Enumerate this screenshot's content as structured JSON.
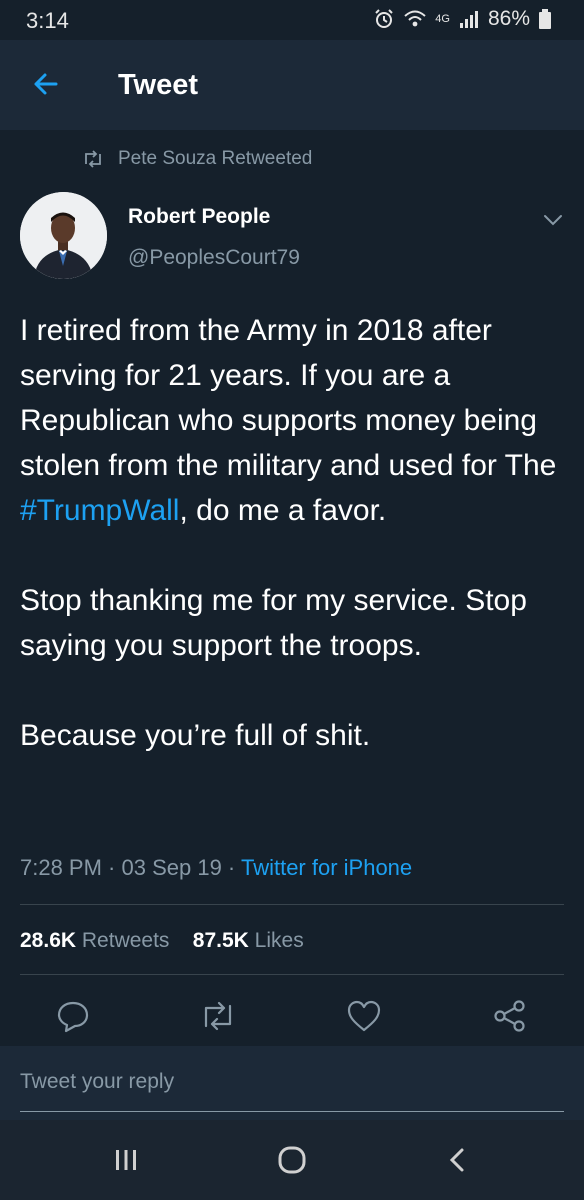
{
  "status_bar": {
    "time": "3:14",
    "battery": "86%",
    "network": "4G"
  },
  "header": {
    "title": "Tweet"
  },
  "retweet_context": {
    "text": "Pete Souza Retweeted"
  },
  "author": {
    "name": "Robert People",
    "handle": "@PeoplesCourt79"
  },
  "tweet": {
    "p1_before": "I retired from the Army in 2018 after serving for 21 years. If you are a Republican who supports money being stolen from the military and used for The ",
    "hashtag": "#TrumpWall",
    "p1_after": ", do me a favor.",
    "p2_line1": "Stop thanking me for my service.",
    "p2_line2": "Stop saying you support the troops.",
    "p3": "Because you’re full of shit."
  },
  "meta": {
    "time": "7:28 PM",
    "sep": " · ",
    "date": "03 Sep 19",
    "source": "Twitter for iPhone"
  },
  "stats": {
    "retweets_count": "28.6K",
    "retweets_label": "Retweets",
    "likes_count": "87.5K",
    "likes_label": "Likes"
  },
  "reply": {
    "placeholder": "Tweet your reply"
  },
  "colors": {
    "background": "#15202b",
    "header": "#1c2938",
    "accent": "#1da1f2",
    "muted": "#8899a6"
  },
  "icons": [
    "back-arrow-icon",
    "retweet-icon",
    "chevron-down-icon",
    "reply-icon",
    "retweet-icon",
    "like-icon",
    "share-icon",
    "recents-icon",
    "home-icon",
    "nav-back-icon"
  ]
}
